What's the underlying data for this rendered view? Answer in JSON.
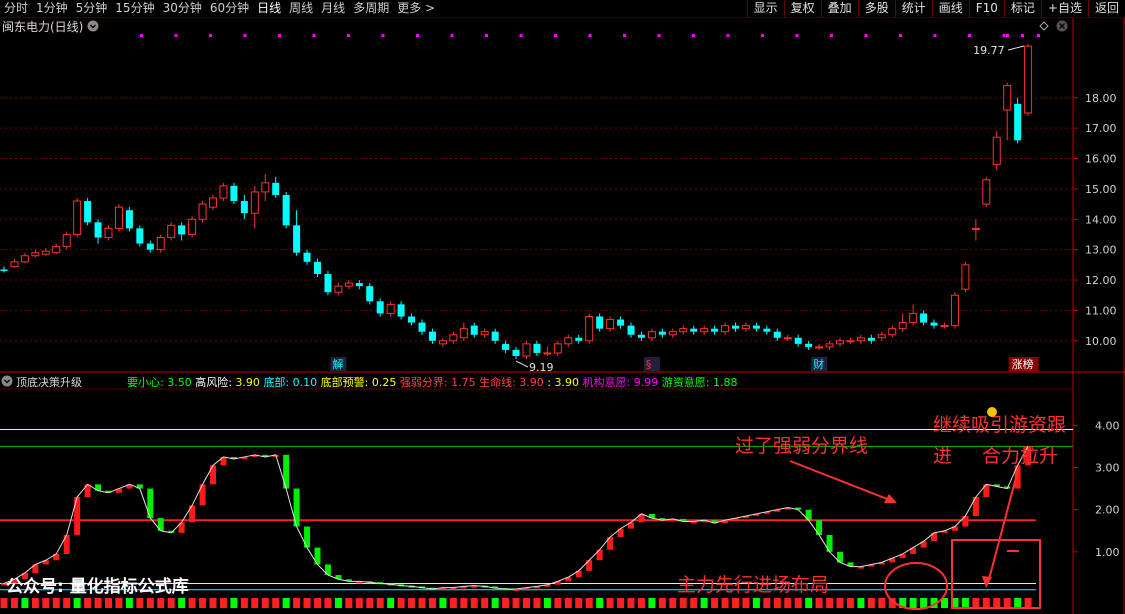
{
  "toolbar": {
    "periods": [
      {
        "label": "分时"
      },
      {
        "label": "1分钟"
      },
      {
        "label": "5分钟"
      },
      {
        "label": "15分钟"
      },
      {
        "label": "30分钟"
      },
      {
        "label": "60分钟"
      },
      {
        "label": "日线",
        "selected": true
      },
      {
        "label": "周线"
      },
      {
        "label": "月线"
      },
      {
        "label": "多周期"
      },
      {
        "label": "更多 >"
      }
    ],
    "actions": [
      {
        "label": "显示"
      },
      {
        "label": "复权"
      },
      {
        "label": "叠加"
      },
      {
        "label": "多股"
      },
      {
        "label": "统计"
      },
      {
        "label": "画线"
      },
      {
        "label": "F10"
      },
      {
        "label": "标记"
      },
      {
        "label": "+自选"
      },
      {
        "label": "返回"
      }
    ]
  },
  "main_chart": {
    "title": "闽东电力(日线)",
    "settings_icon": "chevron-circle-icon",
    "axis_color": "#c00000",
    "price_labels": [
      "18.00",
      "17.00",
      "16.00",
      "15.00",
      "14.00",
      "13.00",
      "12.00",
      "11.00",
      "10.00"
    ],
    "high_marker": "19.77",
    "low_marker": "9.19",
    "event_labels": [
      {
        "text": "解",
        "color": "#00ffff"
      },
      {
        "text": "§",
        "color": "#ff3030"
      },
      {
        "text": "财",
        "color": "#00ffff"
      },
      {
        "text": "涨榜",
        "color": "#ffffff"
      }
    ]
  },
  "chart_data": {
    "type": "candlestick",
    "y_range": [
      9.5,
      20.0
    ],
    "y_ticks": [
      10,
      11,
      12,
      13,
      14,
      15,
      16,
      17,
      18
    ],
    "up_color": "#ff3030",
    "down_color": "#00ffff",
    "candles": [
      [
        12.35,
        12.3,
        12.45,
        12.25
      ],
      [
        12.45,
        12.6,
        12.7,
        12.4
      ],
      [
        12.6,
        12.8,
        12.9,
        12.55
      ],
      [
        12.8,
        12.9,
        13.0,
        12.75
      ],
      [
        12.85,
        12.95,
        13.05,
        12.8
      ],
      [
        12.9,
        13.1,
        13.2,
        12.85
      ],
      [
        13.1,
        13.5,
        13.6,
        13.0
      ],
      [
        13.5,
        14.6,
        14.7,
        13.4
      ],
      [
        14.6,
        13.9,
        14.7,
        13.8
      ],
      [
        13.9,
        13.4,
        14.0,
        13.2
      ],
      [
        13.4,
        13.7,
        13.8,
        13.3
      ],
      [
        13.7,
        14.4,
        14.5,
        13.6
      ],
      [
        14.3,
        13.7,
        14.4,
        13.6
      ],
      [
        13.7,
        13.2,
        13.8,
        13.1
      ],
      [
        13.2,
        13.0,
        13.3,
        12.9
      ],
      [
        13.0,
        13.4,
        13.5,
        12.9
      ],
      [
        13.4,
        13.8,
        13.9,
        13.3
      ],
      [
        13.8,
        13.5,
        13.9,
        13.3
      ],
      [
        13.5,
        14.0,
        14.1,
        13.4
      ],
      [
        14.0,
        14.5,
        14.6,
        13.9
      ],
      [
        14.4,
        14.7,
        14.8,
        14.3
      ],
      [
        14.7,
        15.1,
        15.2,
        14.6
      ],
      [
        15.1,
        14.6,
        15.2,
        14.5
      ],
      [
        14.6,
        14.2,
        14.8,
        14.0
      ],
      [
        14.2,
        14.9,
        15.1,
        13.7
      ],
      [
        14.9,
        15.2,
        15.5,
        14.6
      ],
      [
        15.2,
        14.8,
        15.4,
        14.7
      ],
      [
        14.8,
        13.8,
        14.9,
        13.7
      ],
      [
        13.8,
        12.9,
        14.3,
        12.8
      ],
      [
        12.9,
        12.6,
        13.0,
        12.5
      ],
      [
        12.6,
        12.2,
        12.7,
        12.1
      ],
      [
        12.2,
        11.6,
        12.3,
        11.5
      ],
      [
        11.6,
        11.8,
        11.9,
        11.5
      ],
      [
        11.8,
        11.9,
        12.0,
        11.7
      ],
      [
        11.9,
        11.8,
        12.0,
        11.7
      ],
      [
        11.8,
        11.3,
        11.9,
        11.2
      ],
      [
        11.3,
        10.9,
        11.4,
        10.8
      ],
      [
        10.9,
        11.2,
        11.3,
        10.8
      ],
      [
        11.2,
        10.8,
        11.3,
        10.7
      ],
      [
        10.8,
        10.6,
        10.9,
        10.5
      ],
      [
        10.6,
        10.3,
        10.7,
        10.2
      ],
      [
        10.3,
        10.0,
        10.4,
        9.9
      ],
      [
        9.9,
        10.0,
        10.1,
        9.8
      ],
      [
        10.0,
        10.2,
        10.3,
        9.9
      ],
      [
        10.1,
        10.4,
        10.6,
        10.0
      ],
      [
        10.5,
        10.2,
        10.6,
        10.1
      ],
      [
        10.2,
        10.3,
        10.4,
        10.1
      ],
      [
        10.3,
        10.0,
        10.4,
        9.9
      ],
      [
        9.9,
        9.7,
        10.0,
        9.6
      ],
      [
        9.7,
        9.5,
        9.8,
        9.4
      ],
      [
        9.5,
        9.9,
        10.0,
        9.4
      ],
      [
        9.9,
        9.6,
        10.0,
        9.5
      ],
      [
        9.6,
        9.6,
        9.8,
        9.5
      ],
      [
        9.6,
        9.9,
        10.0,
        9.5
      ],
      [
        9.9,
        10.1,
        10.2,
        9.8
      ],
      [
        10.1,
        10.0,
        10.2,
        9.9
      ],
      [
        10.0,
        10.8,
        10.9,
        9.9
      ],
      [
        10.8,
        10.4,
        10.9,
        10.3
      ],
      [
        10.4,
        10.7,
        10.8,
        10.3
      ],
      [
        10.7,
        10.5,
        10.8,
        10.4
      ],
      [
        10.5,
        10.2,
        10.6,
        10.1
      ],
      [
        10.2,
        10.1,
        10.3,
        10.0
      ],
      [
        10.1,
        10.3,
        10.4,
        10.0
      ],
      [
        10.3,
        10.2,
        10.4,
        10.1
      ],
      [
        10.2,
        10.3,
        10.4,
        10.1
      ],
      [
        10.3,
        10.4,
        10.5,
        10.2
      ],
      [
        10.4,
        10.3,
        10.5,
        10.2
      ],
      [
        10.3,
        10.4,
        10.5,
        10.2
      ],
      [
        10.4,
        10.3,
        10.5,
        10.2
      ],
      [
        10.3,
        10.5,
        10.6,
        10.2
      ],
      [
        10.5,
        10.4,
        10.6,
        10.3
      ],
      [
        10.4,
        10.5,
        10.6,
        10.3
      ],
      [
        10.5,
        10.4,
        10.6,
        10.3
      ],
      [
        10.4,
        10.3,
        10.5,
        10.2
      ],
      [
        10.3,
        10.1,
        10.4,
        10.0
      ],
      [
        10.1,
        10.1,
        10.2,
        10.0
      ],
      [
        10.1,
        9.9,
        10.2,
        9.8
      ],
      [
        9.9,
        9.8,
        10.0,
        9.7
      ],
      [
        9.8,
        9.8,
        9.9,
        9.7
      ],
      [
        9.8,
        9.9,
        10.0,
        9.7
      ],
      [
        9.9,
        10.0,
        10.1,
        9.8
      ],
      [
        10.0,
        10.0,
        10.1,
        9.9
      ],
      [
        10.0,
        10.1,
        10.2,
        9.9
      ],
      [
        10.1,
        10.0,
        10.2,
        9.9
      ],
      [
        10.1,
        10.2,
        10.3,
        10.0
      ],
      [
        10.2,
        10.4,
        10.5,
        10.1
      ],
      [
        10.4,
        10.6,
        10.9,
        10.3
      ],
      [
        10.6,
        10.9,
        11.2,
        10.5
      ],
      [
        10.9,
        10.6,
        11.0,
        10.5
      ],
      [
        10.6,
        10.5,
        10.7,
        10.4
      ],
      [
        10.5,
        10.5,
        10.6,
        10.4
      ],
      [
        10.5,
        11.5,
        11.6,
        10.4
      ],
      [
        11.7,
        12.5,
        12.6,
        11.6
      ],
      [
        13.7,
        13.7,
        14.0,
        13.3
      ],
      [
        14.5,
        15.3,
        15.4,
        14.4
      ],
      [
        15.8,
        16.7,
        16.9,
        15.6
      ],
      [
        17.6,
        18.4,
        18.5,
        16.6
      ],
      [
        17.8,
        16.6,
        18.0,
        16.5
      ],
      [
        17.5,
        19.7,
        19.77,
        17.4
      ]
    ]
  },
  "indicator": {
    "name": "顶底决策升级",
    "params": [
      {
        "label": "要小心:",
        "value": "3.50",
        "color": "#00ff00"
      },
      {
        "label": "高风险:",
        "value": "3.90",
        "color": "#ffffff",
        "vcolor": "#ffff00"
      },
      {
        "label": "底部:",
        "value": "0.10",
        "color": "#00ffff"
      },
      {
        "label": "底部预警:",
        "value": "0.25",
        "color": "#ffff00"
      },
      {
        "label": "强弱分界:",
        "value": "1.75",
        "color": "#ff4040"
      },
      {
        "label": "生命线:",
        "value": "3.90",
        "color": "#ff4040"
      },
      {
        "label": ":",
        "value": "3.90",
        "color": "#ffff00"
      },
      {
        "label": "机构意愿:",
        "value": "9.99",
        "color": "#ff00ff"
      },
      {
        "label": "游资意愿:",
        "value": "1.88",
        "color": "#00ff00"
      }
    ],
    "y_labels": [
      "4.00",
      "3.00",
      "2.00",
      "1.00"
    ],
    "y_range": [
      0,
      4.6
    ],
    "lines": {
      "care": 3.9,
      "risk": 3.5,
      "strength": 1.75,
      "bottom": 0.25
    },
    "values": [
      0.25,
      0.35,
      0.5,
      0.7,
      0.8,
      0.95,
      1.4,
      2.3,
      2.6,
      2.45,
      2.4,
      2.5,
      2.6,
      2.5,
      1.8,
      1.5,
      1.45,
      1.7,
      2.1,
      2.6,
      3.05,
      3.25,
      3.2,
      3.25,
      3.3,
      3.25,
      3.3,
      2.5,
      1.6,
      1.1,
      0.7,
      0.45,
      0.35,
      0.3,
      0.3,
      0.28,
      0.25,
      0.23,
      0.2,
      0.18,
      0.15,
      0.12,
      0.15,
      0.15,
      0.18,
      0.2,
      0.18,
      0.14,
      0.12,
      0.12,
      0.15,
      0.18,
      0.22,
      0.3,
      0.4,
      0.55,
      0.8,
      1.05,
      1.35,
      1.55,
      1.7,
      1.9,
      1.8,
      1.75,
      1.78,
      1.72,
      1.72,
      1.75,
      1.68,
      1.75,
      1.8,
      1.85,
      1.9,
      1.95,
      2.0,
      2.05,
      2.0,
      1.75,
      1.4,
      1.0,
      0.75,
      0.65,
      0.65,
      0.7,
      0.75,
      0.85,
      0.95,
      1.1,
      1.25,
      1.45,
      1.5,
      1.6,
      1.85,
      2.3,
      2.6,
      2.55,
      2.5,
      3.05,
      3.5
    ],
    "annotations": {
      "strength_cross": "过了强弱分界线",
      "follow_line1": "继续吸引游资跟",
      "follow_line2": "进",
      "pull_up": "合力拉升",
      "main_force": "主力先行进场布局"
    },
    "watermark": "公众号: 量化指标公式库"
  }
}
